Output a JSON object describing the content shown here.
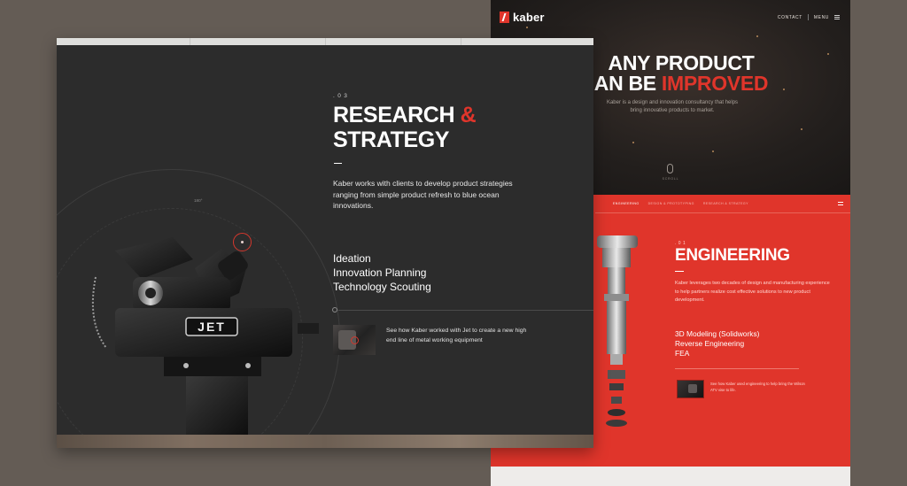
{
  "back": {
    "logo_text": "kaber",
    "nav": {
      "contact": "CONTACT",
      "menu": "MENU"
    },
    "hero": {
      "title_line1": "ANY PRODUCT",
      "title_line2_prefix": "AN BE",
      "title_line2_accent": "IMPROVED",
      "subtitle": "Kaber is a design and innovation consultancy that helps bring innovative products to market.",
      "scroll_label": "SCROLL"
    },
    "engineering": {
      "nav_items": [
        "ENGINEERING",
        "DESIGN & PROTOTYPING",
        "RESEARCH & STRATEGY"
      ],
      "number": ". 0 1",
      "title": "ENGINEERING",
      "body": "Kaber leverages two decades of design and manufacturing experience to help partners realize cost effective solutions to new product development.",
      "services": [
        "3D Modeling (Solidworks)",
        "Reverse Engineering",
        "FEA"
      ],
      "case_text": "See how Kaber used engineering to help bring the Wilson ATV vise to life."
    }
  },
  "front": {
    "section_number": ". 0 3",
    "title_part1": "RESEARCH ",
    "title_amp": "&",
    "title_part2": "STRATEGY",
    "body": "Kaber works with clients to develop product strategies ranging from simple product refresh to blue ocean innovations.",
    "services": [
      "Ideation",
      "Innovation Planning",
      "Technology Scouting"
    ],
    "case_text": "See how Kaber worked with Jet to create a new high end line of metal working equipment",
    "degree_label": "180°",
    "machine_brand": "JET"
  },
  "colors": {
    "accent": "#e0352b",
    "dark_bg": "#2c2c2c",
    "page_bg": "#645c55"
  },
  "icons": [
    "kaber-logo-icon",
    "hamburger-menu-icon",
    "mouse-scroll-icon",
    "target-marker-icon",
    "case-study-thumbnail"
  ]
}
